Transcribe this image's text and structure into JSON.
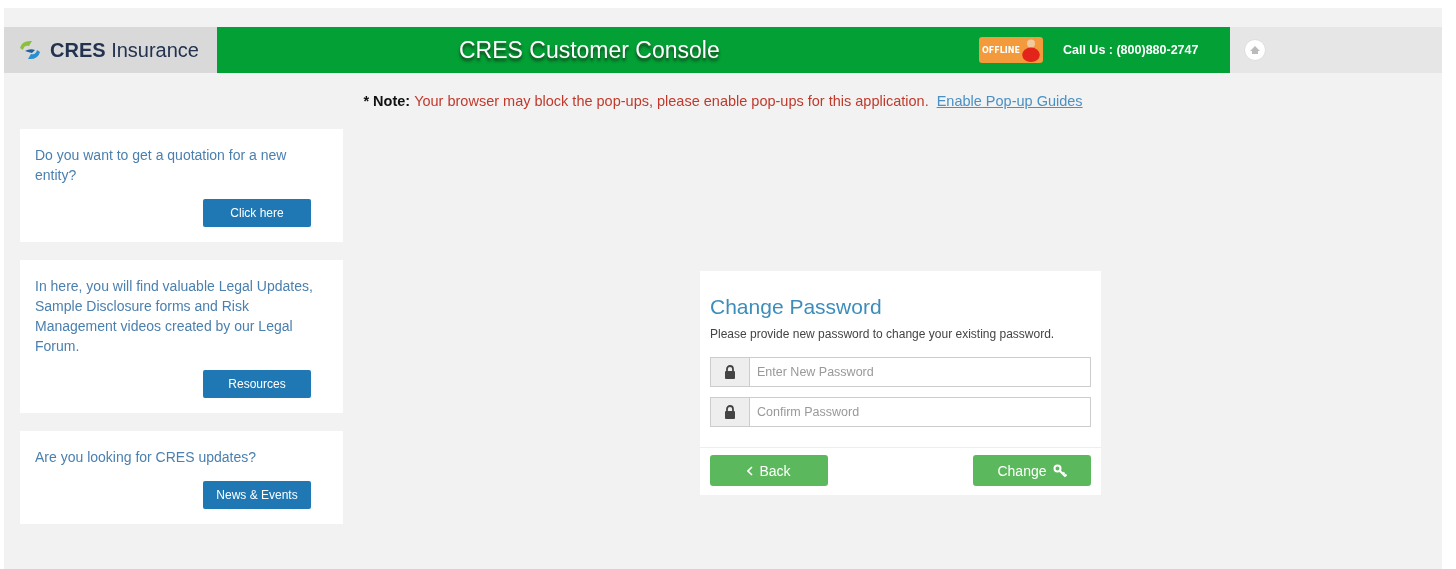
{
  "header": {
    "logo_text": "CRES",
    "logo_suffix": "Insurance",
    "title": "CRES Customer Console",
    "chat_badge": "OFFLINE",
    "phone": "Call Us : (800)880-2747"
  },
  "notice": {
    "label": "* Note:",
    "message": "Your browser may block the pop-ups, please enable pop-ups for this application.",
    "link": "Enable Pop-up Guides"
  },
  "side_cards": [
    {
      "text": "Do you want to get a quotation for a new entity?",
      "button": "Click here"
    },
    {
      "text": "In here, you will find valuable Legal Updates, Sample Disclosure forms and Risk Management videos created by our Legal Forum.",
      "button": "Resources"
    },
    {
      "text": "Are you looking for CRES updates?",
      "button": "News & Events"
    }
  ],
  "change_password": {
    "title": "Change Password",
    "description": "Please provide new password to change your existing password.",
    "fields": [
      {
        "placeholder": "Enter New Password"
      },
      {
        "placeholder": "Confirm Password"
      }
    ],
    "back_button": "Back",
    "submit_button": "Change"
  }
}
